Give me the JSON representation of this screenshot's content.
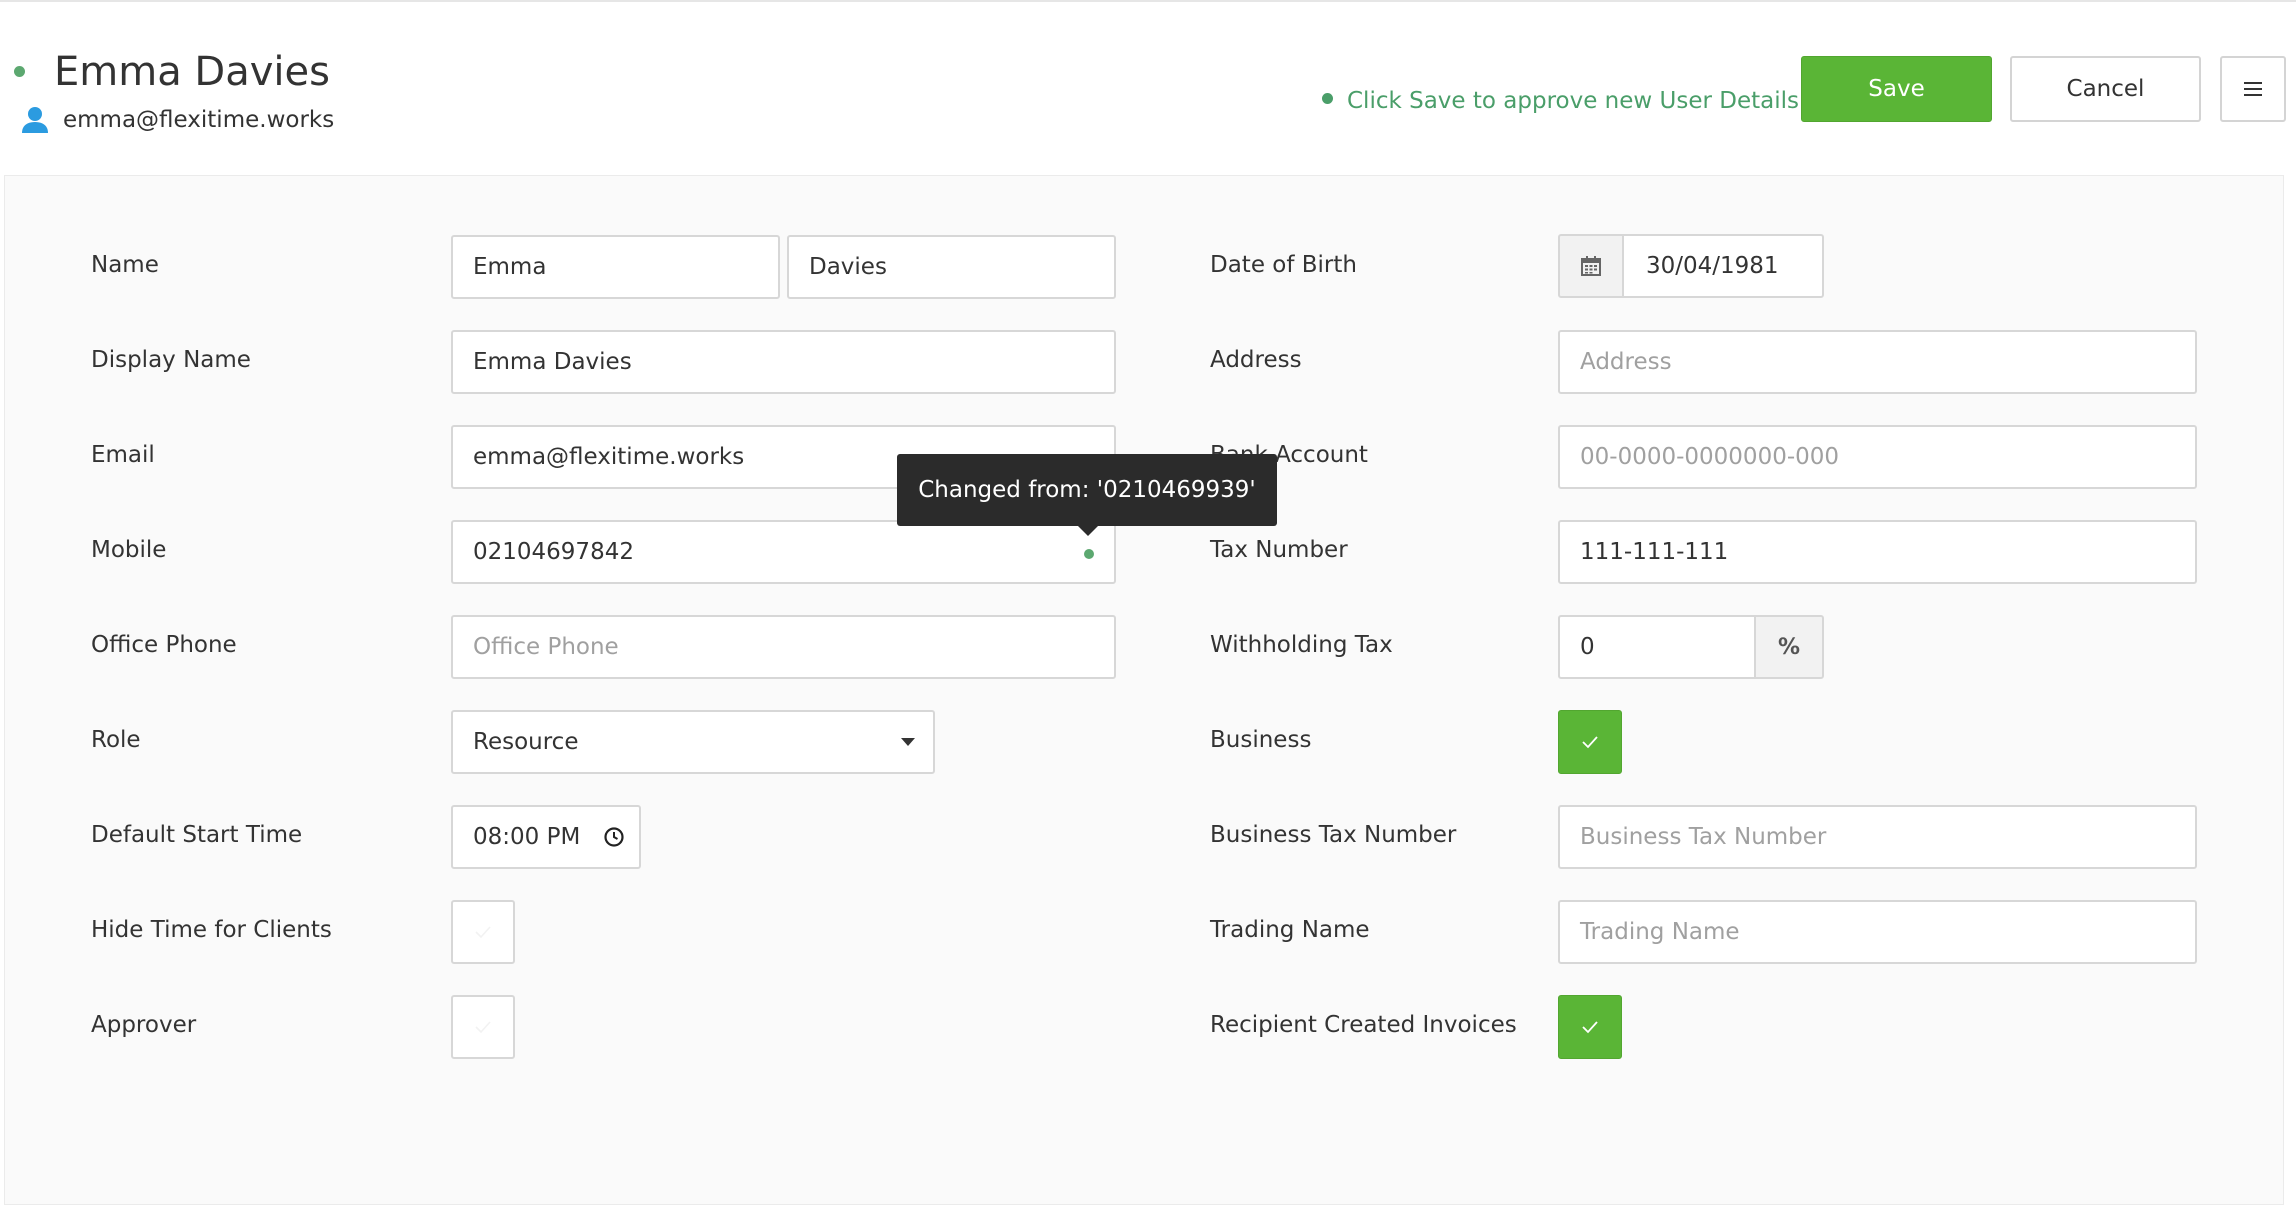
{
  "header": {
    "user_name": "Emma Davies",
    "user_email": "emma@flexitime.works",
    "hint": "Click Save to approve new User Details",
    "save_label": "Save",
    "cancel_label": "Cancel"
  },
  "colors": {
    "accent_green": "#5ab536",
    "status_green": "#4a9e69"
  },
  "left": {
    "name_label": "Name",
    "first_name": "Emma",
    "last_name": "Davies",
    "display_name_label": "Display Name",
    "display_name": "Emma Davies",
    "email_label": "Email",
    "email": "emma@flexitime.works",
    "mobile_label": "Mobile",
    "mobile": "02104697842",
    "office_phone_label": "Office Phone",
    "office_phone_placeholder": "Office Phone",
    "role_label": "Role",
    "role_value": "Resource",
    "start_time_label": "Default Start Time",
    "start_time_value": "08:00 PM",
    "hide_time_label": "Hide Time for Clients",
    "hide_time_checked": false,
    "approver_label": "Approver",
    "approver_checked": false
  },
  "right": {
    "dob_label": "Date of Birth",
    "dob_value": "30/04/1981",
    "address_label": "Address",
    "address_placeholder": "Address",
    "bank_label": "Bank Account",
    "bank_placeholder": "00-0000-0000000-000",
    "tax_label": "Tax Number",
    "tax_value": "111-111-111",
    "withholding_label": "Withholding Tax",
    "withholding_value": "0",
    "withholding_unit": "%",
    "business_label": "Business",
    "business_checked": true,
    "business_tax_label": "Business Tax Number",
    "business_tax_placeholder": "Business Tax Number",
    "trading_label": "Trading Name",
    "trading_placeholder": "Trading Name",
    "rci_label": "Recipient Created Invoices",
    "rci_checked": true
  },
  "tooltip": {
    "text": "Changed from: '0210469939'"
  },
  "icons": {
    "person": "person-icon",
    "calendar": "calendar-icon",
    "clock": "clock-icon",
    "menu": "hamburger-menu-icon",
    "check": "check-icon",
    "caret": "caret-down-icon"
  }
}
